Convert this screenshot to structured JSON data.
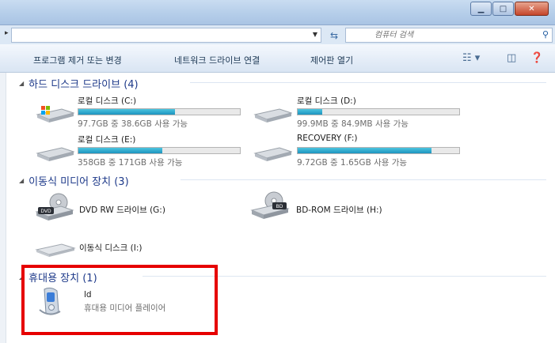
{
  "address": {
    "refresh_icon": "refresh-icon",
    "search_placeholder": "컴퓨터 검색"
  },
  "toolbar": {
    "uninstall": "프로그램 제거 또는 변경",
    "map_drive": "네트워크 드라이브 연결",
    "control_panel": "제어판 열기"
  },
  "groups": {
    "hdd": "하드 디스크 드라이브 (4)",
    "removable": "이동식 미디어 장치 (3)",
    "portable": "휴대용 장치 (1)"
  },
  "drives": [
    {
      "name": "로컬 디스크 (C:)",
      "free": "97.7GB 중 38.6GB 사용 가능",
      "used_fraction": 0.6,
      "icon": "windows-drive-icon"
    },
    {
      "name": "로컬 디스크 (D:)",
      "free": "99.9MB 중 84.9MB 사용 가능",
      "used_fraction": 0.15,
      "icon": "hard-drive-icon"
    },
    {
      "name": "로컬 디스크 (E:)",
      "free": "358GB 중 171GB 사용 가능",
      "used_fraction": 0.52,
      "icon": "hard-drive-icon"
    },
    {
      "name": "RECOVERY (F:)",
      "free": "9.72GB 중 1.65GB 사용 가능",
      "used_fraction": 0.83,
      "icon": "hard-drive-icon"
    }
  ],
  "removable": [
    {
      "name": "DVD RW 드라이브 (G:)",
      "icon": "dvd-drive-icon",
      "badge": "DVD"
    },
    {
      "name": "BD-ROM 드라이브 (H:)",
      "icon": "bd-drive-icon",
      "badge": "BD"
    },
    {
      "name": "이동식 디스크 (I:)",
      "icon": "removable-disk-icon"
    }
  ],
  "portable": [
    {
      "name": "ld",
      "desc": "휴대용 미디어 플레이어",
      "icon": "media-player-icon"
    }
  ],
  "colors": {
    "highlight": "#e60000",
    "bar_fill": "#26a0c9",
    "group_header": "#1e3a8a"
  }
}
